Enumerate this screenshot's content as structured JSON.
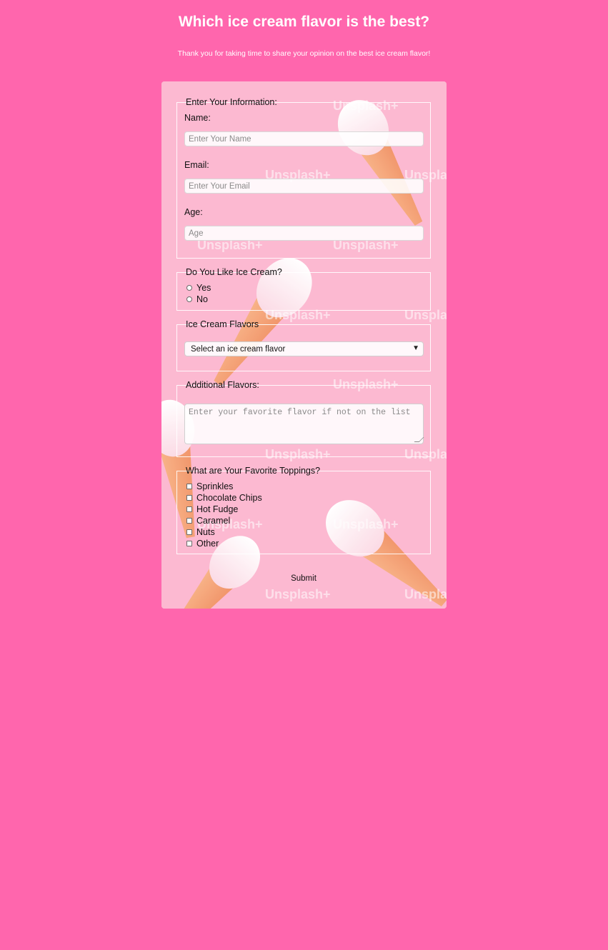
{
  "page": {
    "title": "Which ice cream flavor is the best?",
    "subtitle": "Thank you for taking time to share your opinion on the best ice cream flavor!",
    "background_color": "#ff66ad"
  },
  "info_section": {
    "legend": "Enter Your Information:",
    "name_label": "Name:",
    "name_placeholder": "Enter Your Name",
    "email_label": "Email:",
    "email_placeholder": "Enter Your Email",
    "age_label": "Age:",
    "age_placeholder": "Age"
  },
  "like_section": {
    "legend": "Do You Like Ice Cream?",
    "options": [
      "Yes",
      "No"
    ]
  },
  "flavors_section": {
    "legend": "Ice Cream Flavors",
    "selected": "Select an ice cream flavor"
  },
  "additional_section": {
    "legend": "Additional Flavors:",
    "placeholder": "Enter your favorite flavor if not on the list"
  },
  "toppings_section": {
    "legend": "What are Your Favorite Toppings?",
    "options": [
      "Sprinkles",
      "Chocolate Chips",
      "Hot Fudge",
      "Caramel",
      "Nuts",
      "Other"
    ]
  },
  "submit_label": "Submit",
  "background_image": {
    "icon": "ice-cream-cone-image",
    "watermark": "Unsplash+"
  }
}
